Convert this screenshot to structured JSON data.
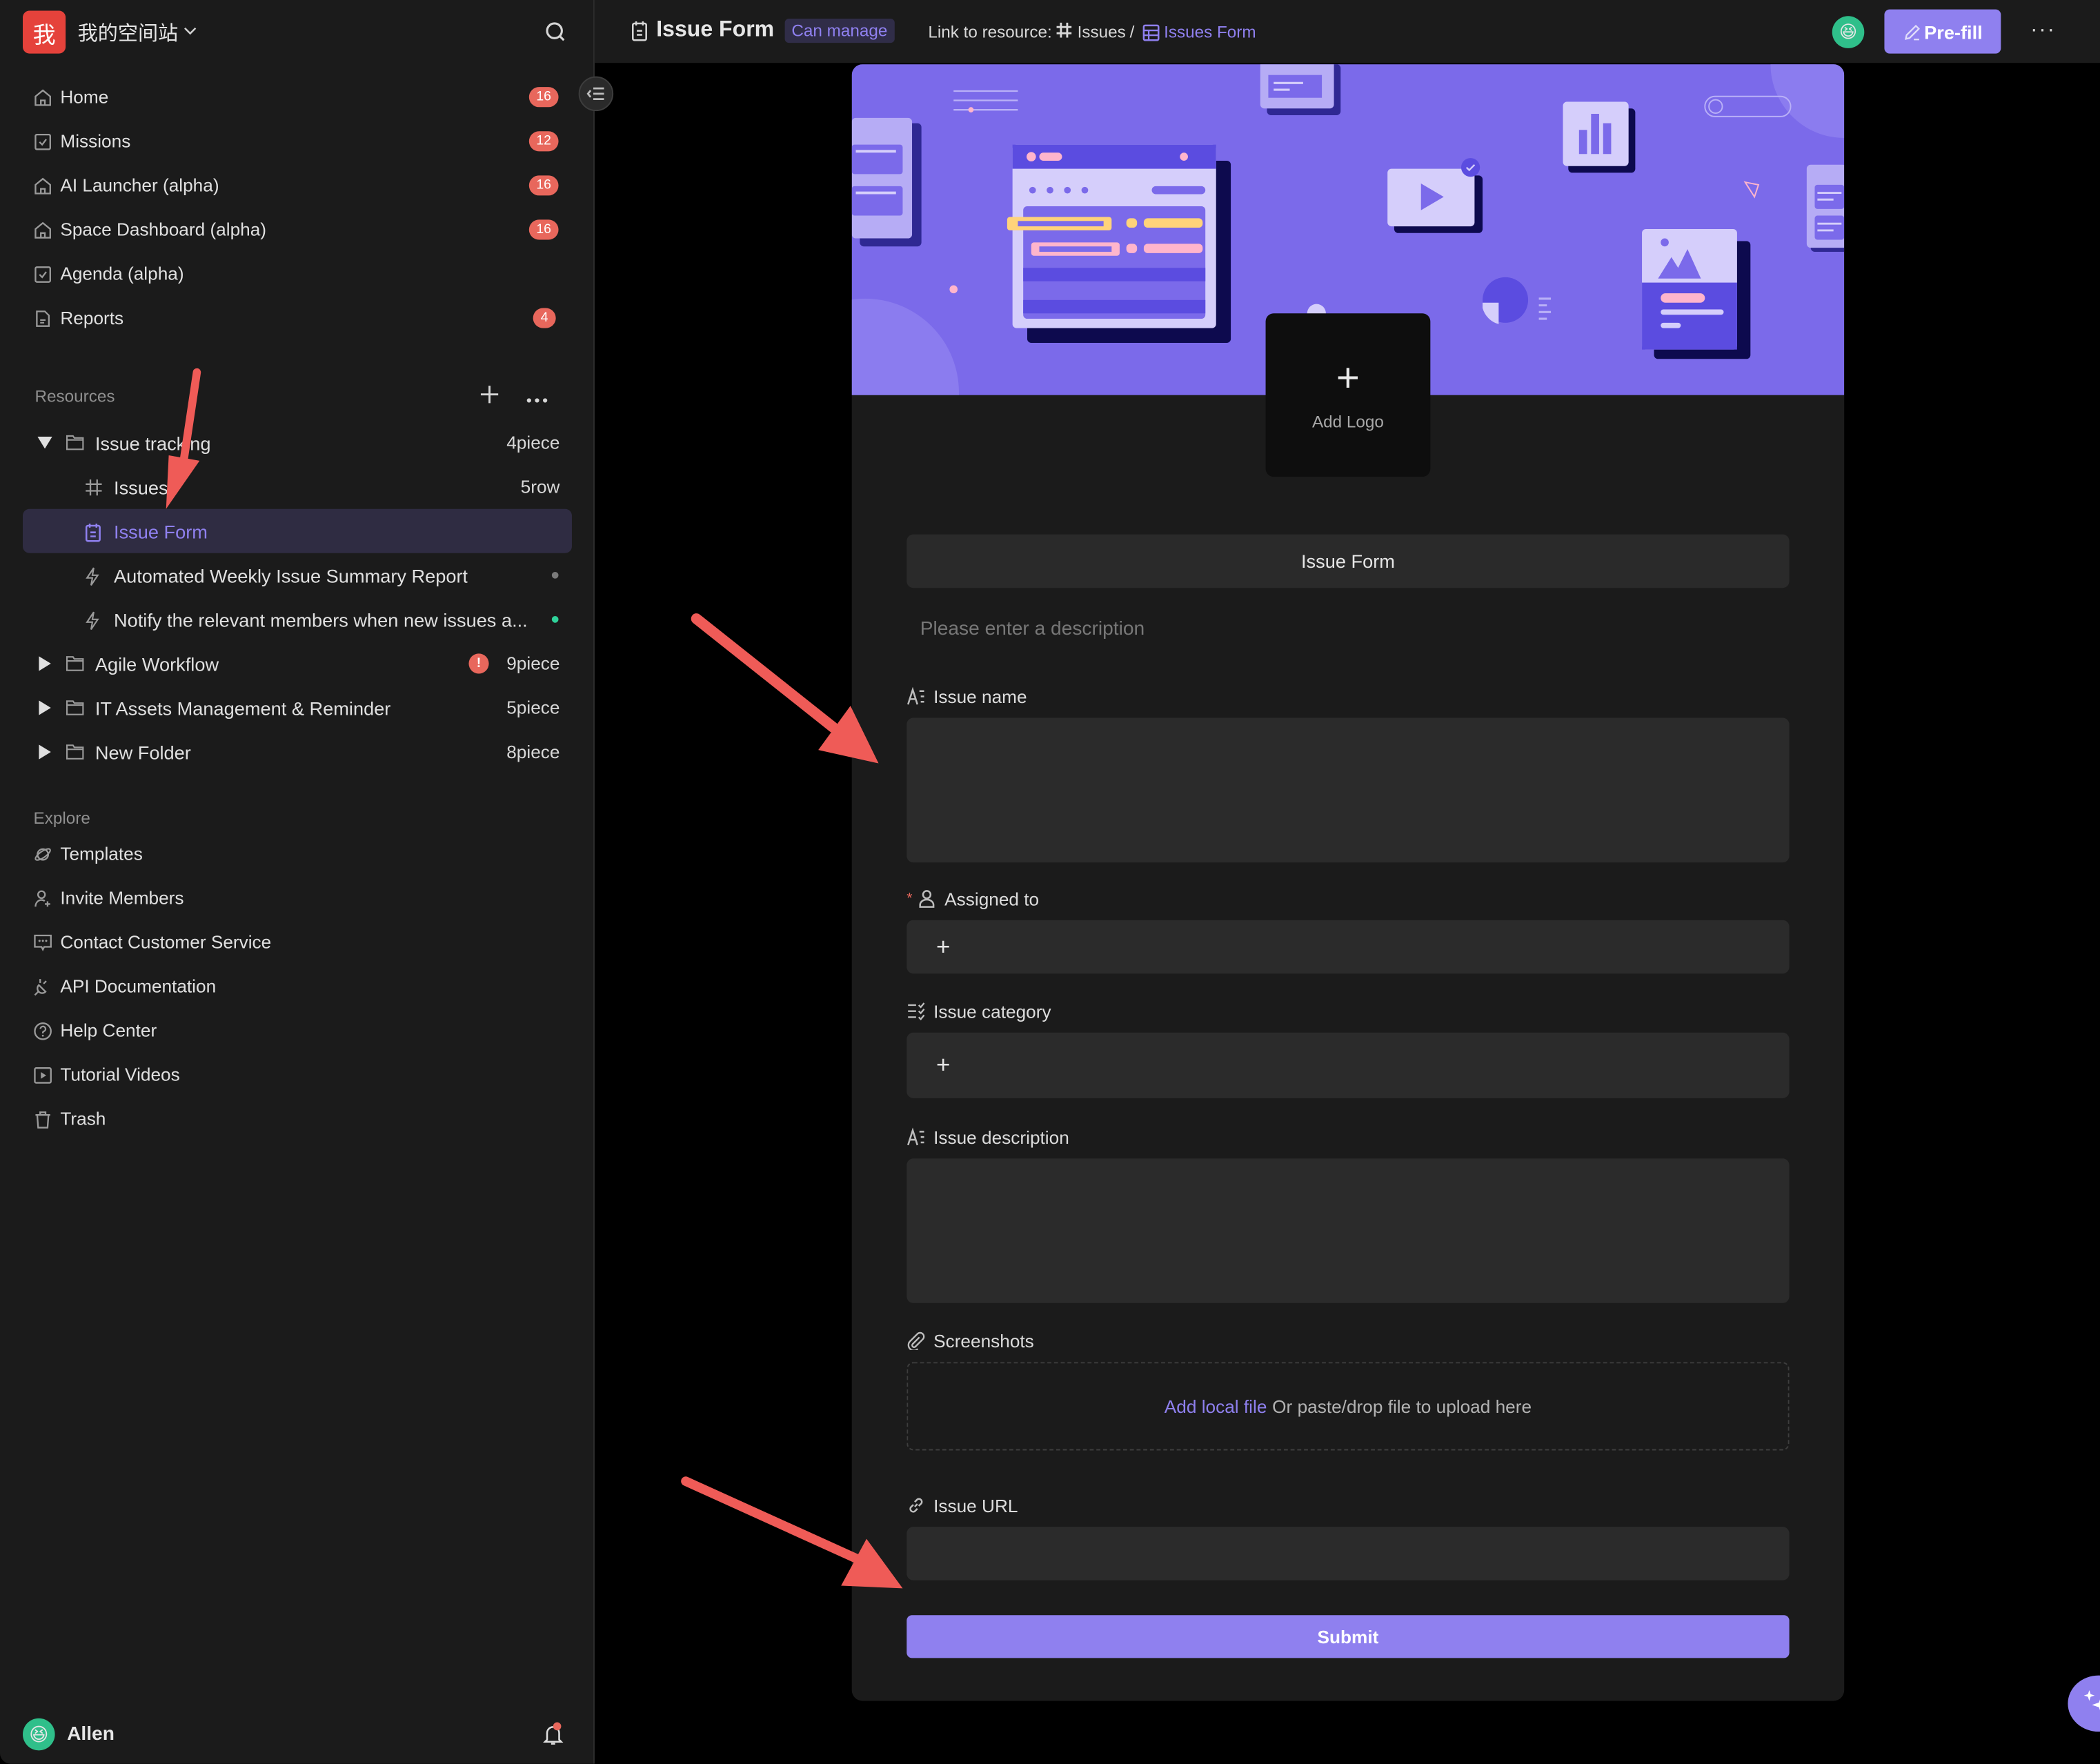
{
  "workspace": {
    "logo_char": "我",
    "name": "我的空间站"
  },
  "sidebar": {
    "nav": [
      {
        "label": "Home",
        "icon": "home-icon",
        "badge": "16"
      },
      {
        "label": "Missions",
        "icon": "checkbox-icon",
        "badge": "12"
      },
      {
        "label": "AI Launcher (alpha)",
        "icon": "home-icon",
        "badge": "16"
      },
      {
        "label": "Space Dashboard (alpha)",
        "icon": "home-icon",
        "badge": "16"
      },
      {
        "label": "Agenda (alpha)",
        "icon": "checkbox-icon",
        "badge": null
      },
      {
        "label": "Reports",
        "icon": "document-icon",
        "badge": "4"
      }
    ],
    "resources_label": "Resources",
    "tree": [
      {
        "label": "Issue tracking",
        "type": "folder",
        "expanded": true,
        "count": "4piece"
      },
      {
        "label": "Issues",
        "type": "datasheet",
        "count": "5row"
      },
      {
        "label": "Issue Form",
        "type": "form",
        "selected": true
      },
      {
        "label": "Automated Weekly Issue Summary Report",
        "type": "automation",
        "status": "inactive"
      },
      {
        "label": "Notify the relevant members when new issues a...",
        "type": "automation",
        "status": "active"
      },
      {
        "label": "Agile Workflow",
        "type": "folder",
        "expanded": false,
        "count": "9piece",
        "warning": "!"
      },
      {
        "label": "IT Assets Management & Reminder",
        "type": "folder",
        "expanded": false,
        "count": "5piece"
      },
      {
        "label": "New Folder",
        "type": "folder",
        "expanded": false,
        "count": "8piece"
      }
    ],
    "explore_label": "Explore",
    "explore": [
      {
        "label": "Templates",
        "icon": "planet-icon"
      },
      {
        "label": "Invite Members",
        "icon": "add-user-icon"
      },
      {
        "label": "Contact Customer Service",
        "icon": "chat-icon"
      },
      {
        "label": "API Documentation",
        "icon": "plug-icon"
      },
      {
        "label": "Help Center",
        "icon": "help-icon"
      },
      {
        "label": "Tutorial Videos",
        "icon": "video-icon"
      },
      {
        "label": "Trash",
        "icon": "trash-icon"
      }
    ],
    "user": {
      "name": "Allen",
      "avatar_emoji": "😆"
    }
  },
  "topbar": {
    "title": "Issue Form",
    "permission": "Can manage",
    "link_prefix": "Link to resource:",
    "link_datasheet": "Issues",
    "link_separator": "/",
    "link_view": "Issues Form",
    "prefill_label": "Pre-fill",
    "avatar_emoji": "😆",
    "more": "···"
  },
  "form": {
    "logo_label": "Add Logo",
    "logo_plus": "+",
    "title": "Issue Form",
    "description_placeholder": "Please enter a description",
    "fields": [
      {
        "label": "Issue name",
        "icon": "text-field-icon",
        "required": false,
        "type": "textarea",
        "value": ""
      },
      {
        "label": "Assigned to",
        "icon": "member-icon",
        "required": true,
        "type": "member",
        "value": ""
      },
      {
        "label": "Issue category",
        "icon": "multi-select-icon",
        "required": false,
        "type": "select",
        "value": ""
      },
      {
        "label": "Issue description",
        "icon": "text-field-icon",
        "required": false,
        "type": "textarea",
        "value": ""
      },
      {
        "label": "Screenshots",
        "icon": "attachment-icon",
        "required": false,
        "type": "attachment"
      },
      {
        "label": "Issue URL",
        "icon": "link-icon",
        "required": false,
        "type": "url",
        "value": ""
      }
    ],
    "required_mark": "*",
    "add_plus": "+",
    "upload_link": "Add local file",
    "upload_hint": "Or paste/drop file to upload here",
    "submit_label": "Submit"
  },
  "colors": {
    "accent": "#8f80ef",
    "banner": "#7b6aea",
    "badge": "#e8675c",
    "annotation_arrow": "#ef5b57",
    "sidebar_bg": "#1b1b1b",
    "page_bg": "#000000"
  }
}
